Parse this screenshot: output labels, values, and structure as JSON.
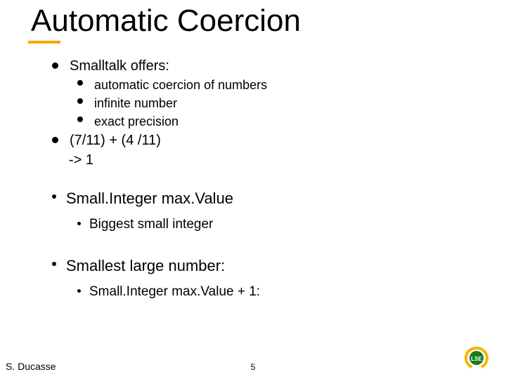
{
  "title": "Automatic Coercion",
  "bullets": {
    "b1": "Smalltalk offers:",
    "b1a": "automatic coercion of numbers",
    "b1b": "infinite number",
    "b1c": "exact precision",
    "b2": "(7/11) + (4 /11)",
    "b2r": "-> 1",
    "b3": "Small.Integer max.Value",
    "b3a": "Biggest small integer",
    "b4": "Smallest large number:",
    "b4a": "Small.Integer max.Value + 1:"
  },
  "footer": {
    "author": "S. Ducasse",
    "page": "5"
  },
  "logo_text": "LSE"
}
